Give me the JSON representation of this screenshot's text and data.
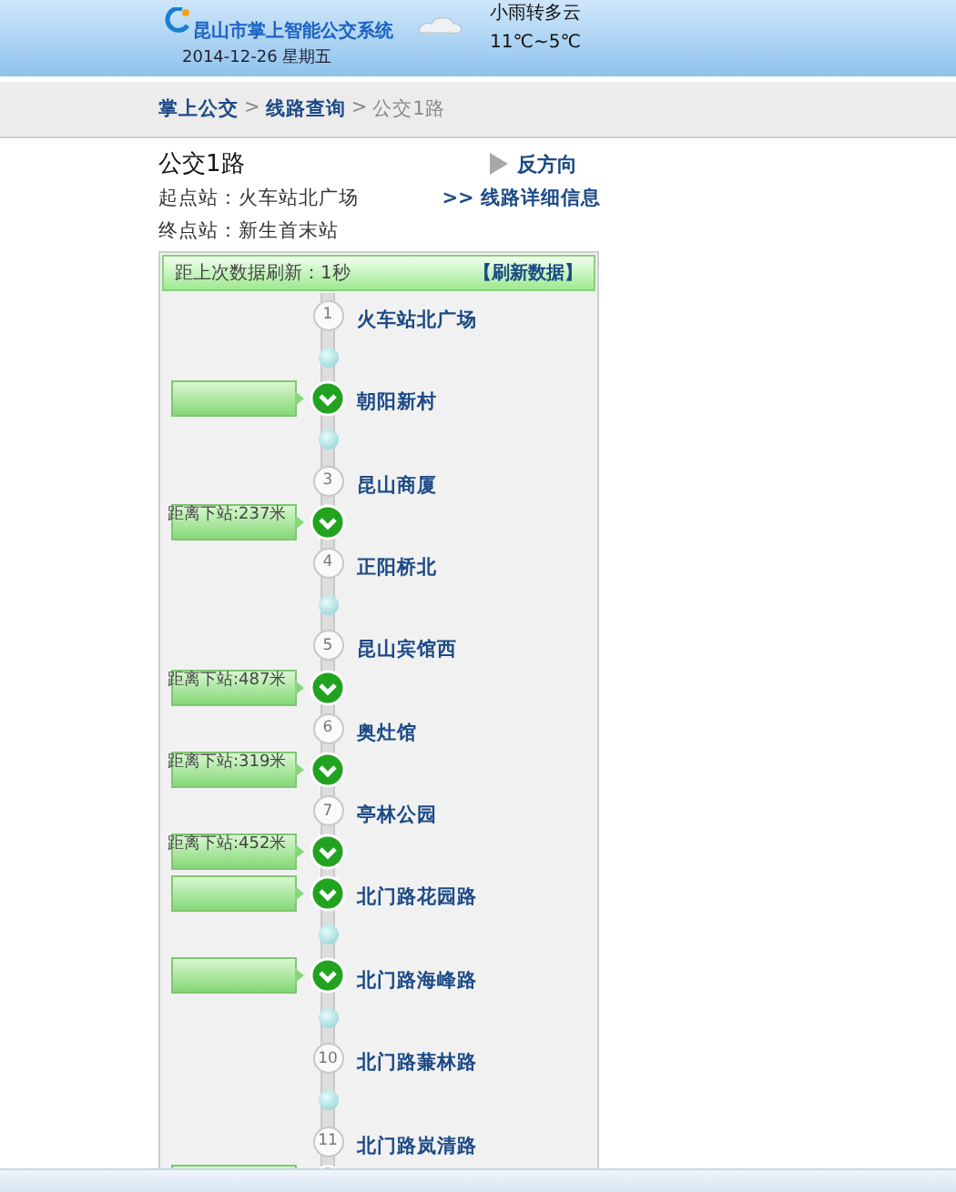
{
  "header": {
    "site_title": "昆山市掌上智能公交系统",
    "date": "2014-12-26",
    "weekday": "星期五",
    "weather": "小雨转多云",
    "temperature": "11℃~5℃"
  },
  "breadcrumb": [
    {
      "label": "掌上公交",
      "link": true
    },
    {
      "separator": ">",
      "label": "线路查询",
      "link": true
    },
    {
      "separator": ">",
      "label": "公交1路",
      "link": false
    }
  ],
  "route": {
    "name": "公交1路",
    "reverse": "反方向",
    "start": "起点站：火车站北广场",
    "end": "终点站：新生首末站",
    "detail_link": ">> 线路详细信息"
  },
  "refresh": {
    "elapsed": "距上次数据刷新：1秒",
    "button": "【刷新数据】"
  },
  "timeline": [
    {
      "kind": "stop",
      "number": "1",
      "name": "火车站北广场"
    },
    {
      "kind": "gap"
    },
    {
      "kind": "bus_stop",
      "name": "朝阳新村"
    },
    {
      "kind": "gap"
    },
    {
      "kind": "stop",
      "number": "3",
      "name": "昆山商厦"
    },
    {
      "kind": "bus",
      "distance": "距离下站:237米"
    },
    {
      "kind": "stop",
      "number": "4",
      "name": "正阳桥北"
    },
    {
      "kind": "gap"
    },
    {
      "kind": "stop",
      "number": "5",
      "name": "昆山宾馆西"
    },
    {
      "kind": "bus",
      "distance": "距离下站:487米"
    },
    {
      "kind": "stop",
      "number": "6",
      "name": "奥灶馆"
    },
    {
      "kind": "bus",
      "distance": "距离下站:319米"
    },
    {
      "kind": "stop",
      "number": "7",
      "name": "亭林公园"
    },
    {
      "kind": "bus",
      "distance": "距离下站:452米"
    },
    {
      "kind": "bus_stop",
      "name": "北门路花园路"
    },
    {
      "kind": "gap"
    },
    {
      "kind": "bus_stop",
      "name": "北门路海峰路"
    },
    {
      "kind": "gap"
    },
    {
      "kind": "stop",
      "number": "10",
      "name": "北门路蒹林路"
    },
    {
      "kind": "gap"
    },
    {
      "kind": "stop",
      "number": "11",
      "name": "北门路岚清路"
    },
    {
      "kind": "bus"
    }
  ]
}
